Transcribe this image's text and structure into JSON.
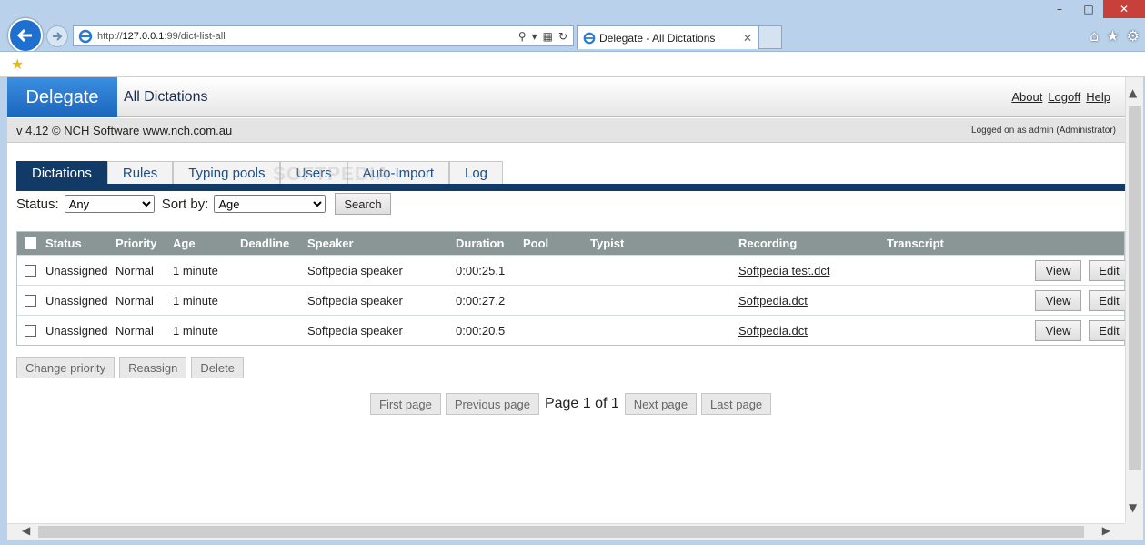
{
  "browser": {
    "address": {
      "prefix": "http://",
      "host": "127.0.0.1",
      "path": ":99/dict-list-all"
    },
    "tab_title": "Delegate - All Dictations"
  },
  "header": {
    "brand": "Delegate",
    "title": "All Dictations",
    "links": {
      "about": "About",
      "logoff": "Logoff",
      "help": "Help"
    }
  },
  "version_bar": {
    "version": "v 4.12 © NCH Software ",
    "site": "www.nch.com.au",
    "logged_on": "Logged on as admin (Administrator)"
  },
  "tabs": [
    "Dictations",
    "Rules",
    "Typing pools",
    "Users",
    "Auto-Import",
    "Log"
  ],
  "watermark": "SOFTPEDIA",
  "filters": {
    "status_label": "Status:",
    "status_value": "Any",
    "sort_label": "Sort by:",
    "sort_value": "Age",
    "search": "Search"
  },
  "table": {
    "headers": {
      "status": "Status",
      "priority": "Priority",
      "age": "Age",
      "deadline": "Deadline",
      "speaker": "Speaker",
      "duration": "Duration",
      "pool": "Pool",
      "typist": "Typist",
      "recording": "Recording",
      "transcript": "Transcript"
    },
    "rows": [
      {
        "status": "Unassigned",
        "priority": "Normal",
        "age": "1 minute",
        "deadline": "",
        "speaker": "Softpedia speaker",
        "duration": "0:00:25.1",
        "pool": "",
        "typist": "",
        "recording": "Softpedia test.dct",
        "transcript": "",
        "view": "View",
        "edit": "Edit"
      },
      {
        "status": "Unassigned",
        "priority": "Normal",
        "age": "1 minute",
        "deadline": "",
        "speaker": "Softpedia speaker",
        "duration": "0:00:27.2",
        "pool": "",
        "typist": "",
        "recording": "Softpedia.dct",
        "transcript": "",
        "view": "View",
        "edit": "Edit"
      },
      {
        "status": "Unassigned",
        "priority": "Normal",
        "age": "1 minute",
        "deadline": "",
        "speaker": "Softpedia speaker",
        "duration": "0:00:20.5",
        "pool": "",
        "typist": "",
        "recording": "Softpedia.dct",
        "transcript": "",
        "view": "View",
        "edit": "Edit"
      }
    ]
  },
  "bulk_actions": {
    "change_priority": "Change priority",
    "reassign": "Reassign",
    "delete": "Delete"
  },
  "pager": {
    "first": "First page",
    "previous": "Previous page",
    "page_text": "Page 1 of 1",
    "next": "Next page",
    "last": "Last page"
  }
}
